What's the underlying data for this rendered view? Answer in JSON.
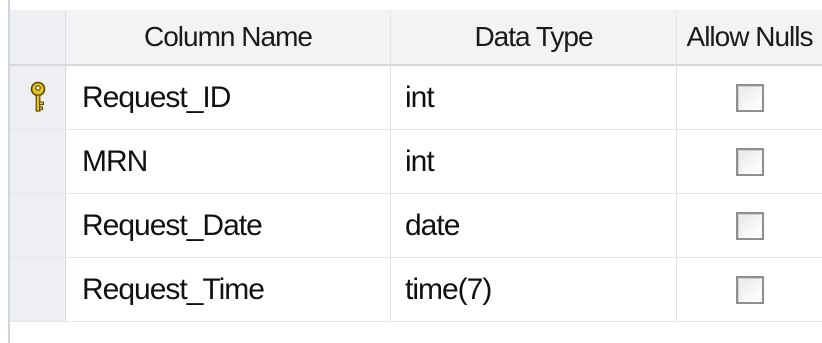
{
  "table": {
    "headers": {
      "column_name": "Column Name",
      "data_type": "Data Type",
      "allow_nulls": "Allow Nulls"
    },
    "rows": [
      {
        "column_name": "Request_ID",
        "data_type": "int",
        "allow_nulls": false,
        "primary_key": true
      },
      {
        "column_name": "MRN",
        "data_type": "int",
        "allow_nulls": false,
        "primary_key": false
      },
      {
        "column_name": "Request_Date",
        "data_type": "date",
        "allow_nulls": false,
        "primary_key": false
      },
      {
        "column_name": "Request_Time",
        "data_type": "time(7)",
        "allow_nulls": false,
        "primary_key": false
      }
    ]
  },
  "icons": {
    "primary_key": "key-icon"
  },
  "colors": {
    "key_gold": "#e8c320",
    "row_selector": "#eeeff2"
  }
}
